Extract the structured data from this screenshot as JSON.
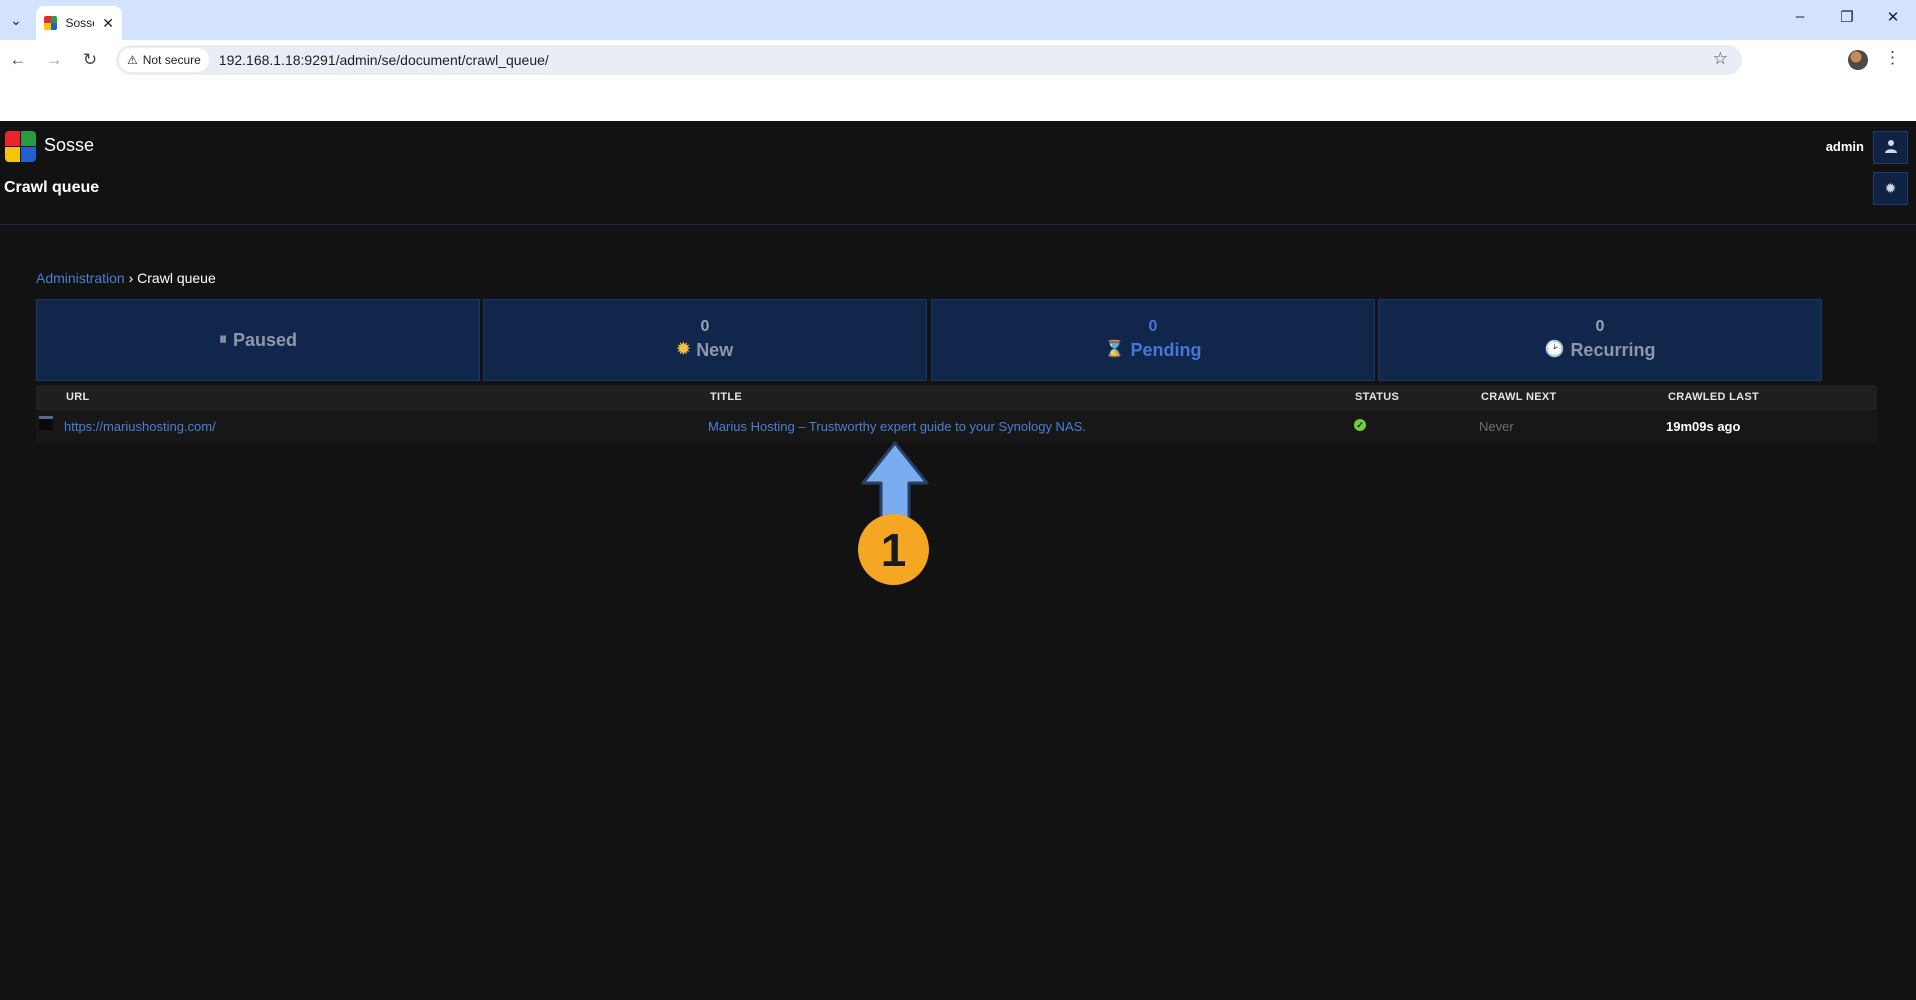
{
  "browser": {
    "tab_title": "Sosse",
    "security_label": "Not secure",
    "url": "192.168.1.18:9291/admin/se/document/crawl_queue/",
    "icons": {
      "tab_search": "chevron-down-icon",
      "close": "close-icon",
      "back": "back-arrow-icon",
      "forward": "forward-arrow-icon",
      "reload": "reload-icon",
      "warning": "warning-icon",
      "bookmark": "star-icon",
      "menu": "kebab-icon"
    }
  },
  "app": {
    "brand": "Sosse",
    "page_title": "Crawl queue",
    "user": "admin",
    "logo_colors": [
      "#e8262b",
      "#2b9a3e",
      "#f7c400",
      "#1f5fd1"
    ]
  },
  "breadcrumb": {
    "home": "Administration",
    "separator": "›",
    "current": "Crawl queue"
  },
  "cards": [
    {
      "label": "Paused",
      "count": "",
      "icon": "pause-icon",
      "active": false
    },
    {
      "label": "New",
      "count": "0",
      "icon": "sun-icon",
      "active": false
    },
    {
      "label": "Pending",
      "count": "0",
      "icon": "hourglass-icon",
      "active": true
    },
    {
      "label": "Recurring",
      "count": "0",
      "icon": "clock-icon",
      "active": false
    }
  ],
  "table": {
    "headers": {
      "url": "URL",
      "title": "TITLE",
      "status": "STATUS",
      "crawl_next": "CRAWL NEXT",
      "crawled_last": "CRAWLED LAST"
    },
    "rows": [
      {
        "url": "https://mariushosting.com/",
        "title": "Marius Hosting – Trustworthy expert guide to your Synology NAS.",
        "status": "ok",
        "crawl_next": "Never",
        "crawled_last": "19m09s ago"
      }
    ]
  },
  "annotation": {
    "number": "1",
    "color": "#f5a623",
    "arrow_color": "#7aacf0"
  },
  "colors": {
    "accent": "#4a7fd6",
    "card_bg": "#10264a",
    "page_bg": "#121212"
  }
}
